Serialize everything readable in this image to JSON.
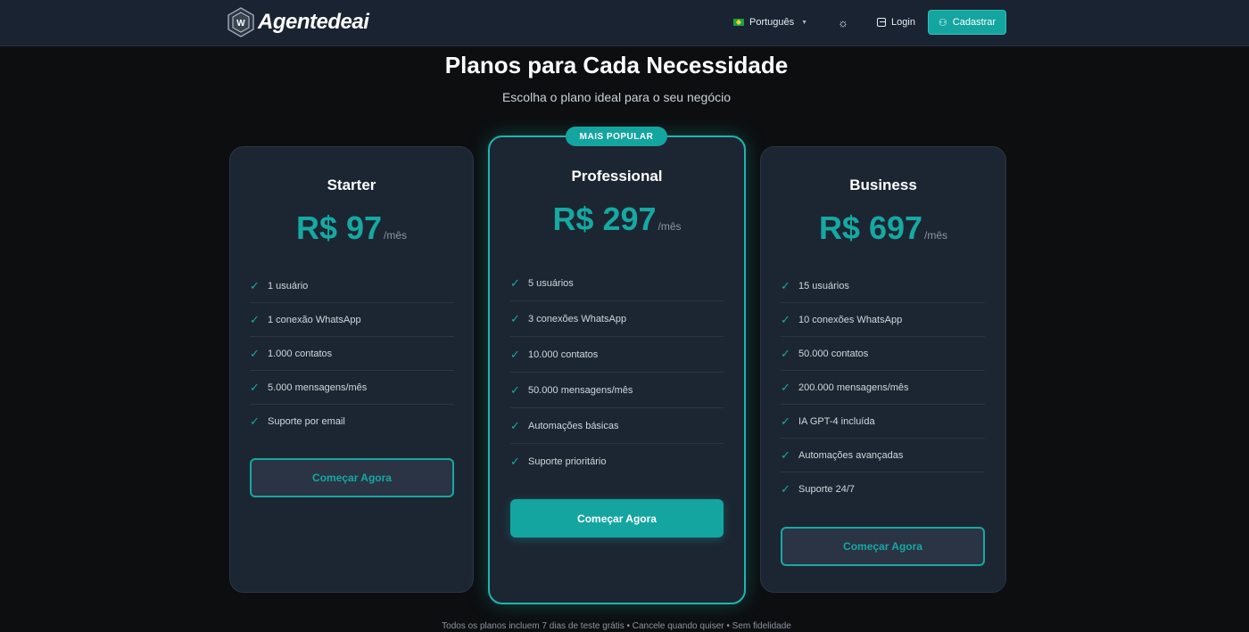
{
  "header": {
    "brand": "Agentedeai",
    "language": "Português",
    "login_label": "Login",
    "signup_label": "Cadastrar"
  },
  "hero": {
    "title": "Planos para Cada Necessidade",
    "subtitle": "Escolha o plano ideal para o seu negócio"
  },
  "plans": [
    {
      "name": "Starter",
      "price": "R$ 97",
      "period": "/mês",
      "features": [
        "1 usuário",
        "1 conexão WhatsApp",
        "1.000 contatos",
        "5.000 mensagens/mês",
        "Suporte por email"
      ],
      "cta": "Começar Agora"
    },
    {
      "name": "Professional",
      "badge": "MAIS POPULAR",
      "price": "R$ 297",
      "period": "/mês",
      "features": [
        "5 usuários",
        "3 conexões WhatsApp",
        "10.000 contatos",
        "50.000 mensagens/mês",
        "Automações básicas",
        "Suporte prioritário"
      ],
      "cta": "Começar Agora"
    },
    {
      "name": "Business",
      "price": "R$ 697",
      "period": "/mês",
      "features": [
        "15 usuários",
        "10 conexões WhatsApp",
        "50.000 contatos",
        "200.000 mensagens/mês",
        "IA GPT-4 incluída",
        "Automações avançadas",
        "Suporte 24/7"
      ],
      "cta": "Começar Agora"
    }
  ],
  "footnote": "Todos os planos incluem 7 dias de teste grátis • Cancele quando quiser • Sem fidelidade",
  "colors": {
    "accent": "#14a5a0",
    "background": "#0d0e10",
    "card": "#1c2632",
    "navbar": "#1a2331"
  },
  "icons": {
    "logo": "hexagon-w-logo-icon",
    "flag": "brazil-flag-icon",
    "theme": "sun-icon",
    "login": "login-icon",
    "signup": "user-plus-icon",
    "feature": "check-icon"
  }
}
